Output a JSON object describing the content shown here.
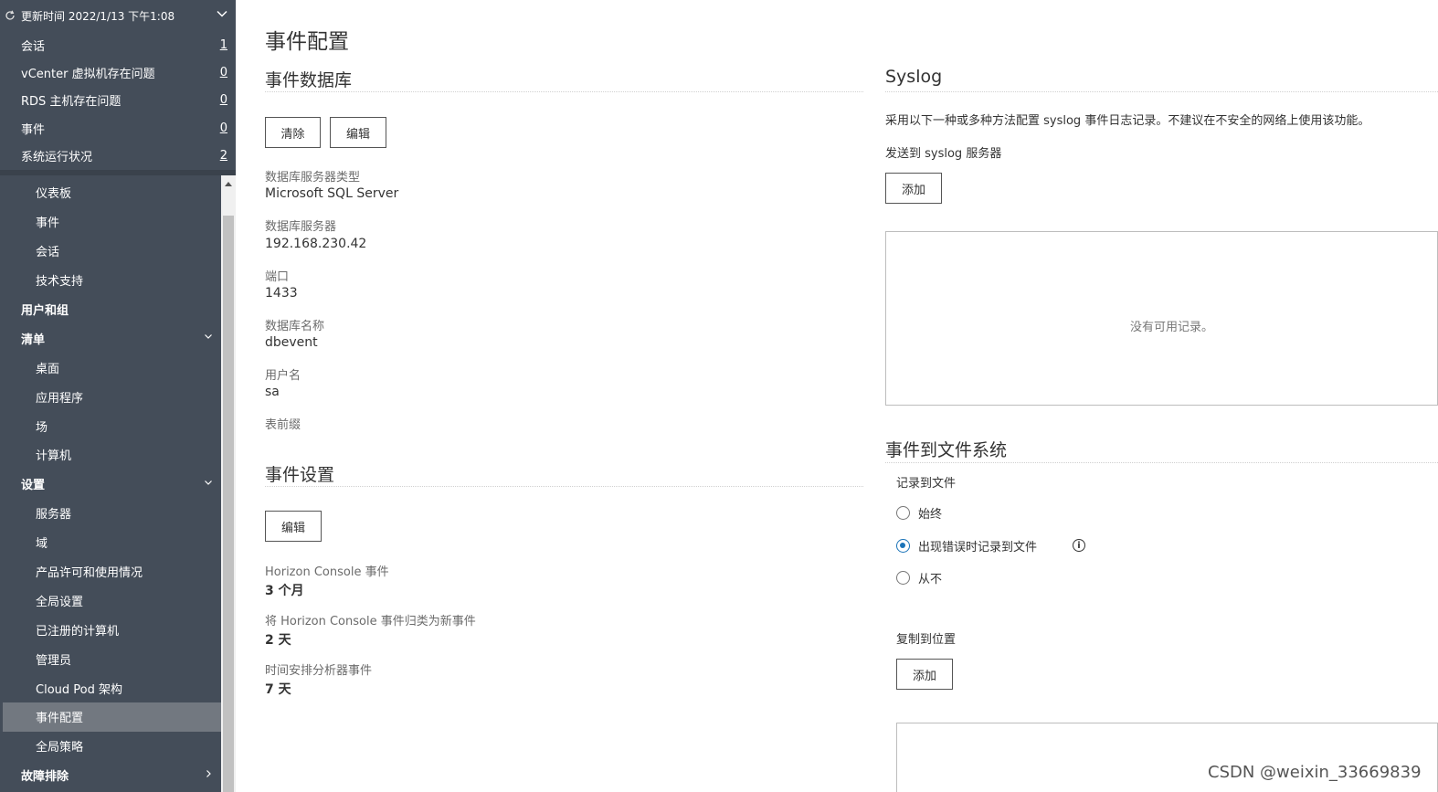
{
  "sidebar": {
    "refresh_label": "更新时间 2022/1/13 下午1:08",
    "summary": [
      {
        "label": "会话",
        "count": "1"
      },
      {
        "label": "vCenter 虚拟机存在问题",
        "count": "0"
      },
      {
        "label": "RDS 主机存在问题",
        "count": "0"
      },
      {
        "label": "事件",
        "count": "0"
      },
      {
        "label": "系统运行状况",
        "count": "2"
      }
    ],
    "nav": [
      {
        "label": "仪表板"
      },
      {
        "label": "事件"
      },
      {
        "label": "会话"
      },
      {
        "label": "技术支持"
      },
      {
        "label": "用户和组"
      },
      {
        "label": "清单"
      },
      {
        "label": "桌面"
      },
      {
        "label": "应用程序"
      },
      {
        "label": "场"
      },
      {
        "label": "计算机"
      },
      {
        "label": "设置"
      },
      {
        "label": "服务器"
      },
      {
        "label": "域"
      },
      {
        "label": "产品许可和使用情况"
      },
      {
        "label": "全局设置"
      },
      {
        "label": "已注册的计算机"
      },
      {
        "label": "管理员"
      },
      {
        "label": "Cloud Pod 架构"
      },
      {
        "label": "事件配置"
      },
      {
        "label": "全局策略"
      },
      {
        "label": "故障排除"
      }
    ]
  },
  "main": {
    "page_title": "事件配置",
    "event_db": {
      "title": "事件数据库",
      "clear_label": "清除",
      "edit_label": "编辑",
      "fields": [
        {
          "label": "数据库服务器类型",
          "value": "Microsoft SQL Server"
        },
        {
          "label": "数据库服务器",
          "value": "192.168.230.42"
        },
        {
          "label": "端口",
          "value": "1433"
        },
        {
          "label": "数据库名称",
          "value": "dbevent"
        },
        {
          "label": "用户名",
          "value": "sa"
        },
        {
          "label": "表前缀",
          "value": ""
        }
      ]
    },
    "event_settings": {
      "title": "事件设置",
      "edit_label": "编辑",
      "fields": [
        {
          "label": "Horizon Console 事件",
          "value": "3 个月"
        },
        {
          "label": "将 Horizon Console 事件归类为新事件",
          "value": "2 天"
        },
        {
          "label": "时间安排分析器事件",
          "value": "7 天"
        }
      ]
    },
    "syslog": {
      "title": "Syslog",
      "description": "采用以下一种或多种方法配置 syslog 事件日志记录。不建议在不安全的网络上使用该功能。",
      "send_label": "发送到 syslog 服务器",
      "add_label": "添加",
      "empty_text": "没有可用记录。"
    },
    "file_system": {
      "title": "事件到文件系统",
      "log_to_file_label": "记录到文件",
      "options": [
        {
          "label": "始终",
          "checked": false
        },
        {
          "label": "出现错误时记录到文件",
          "checked": true
        },
        {
          "label": "从不",
          "checked": false
        }
      ],
      "copy_label": "复制到位置",
      "add_label": "添加"
    }
  },
  "watermark": "CSDN @weixin_33669839",
  "colors": {
    "sidebar_bg": "#444d59",
    "selected_bg": "#727880",
    "radio_checked": "#1a73b8"
  }
}
